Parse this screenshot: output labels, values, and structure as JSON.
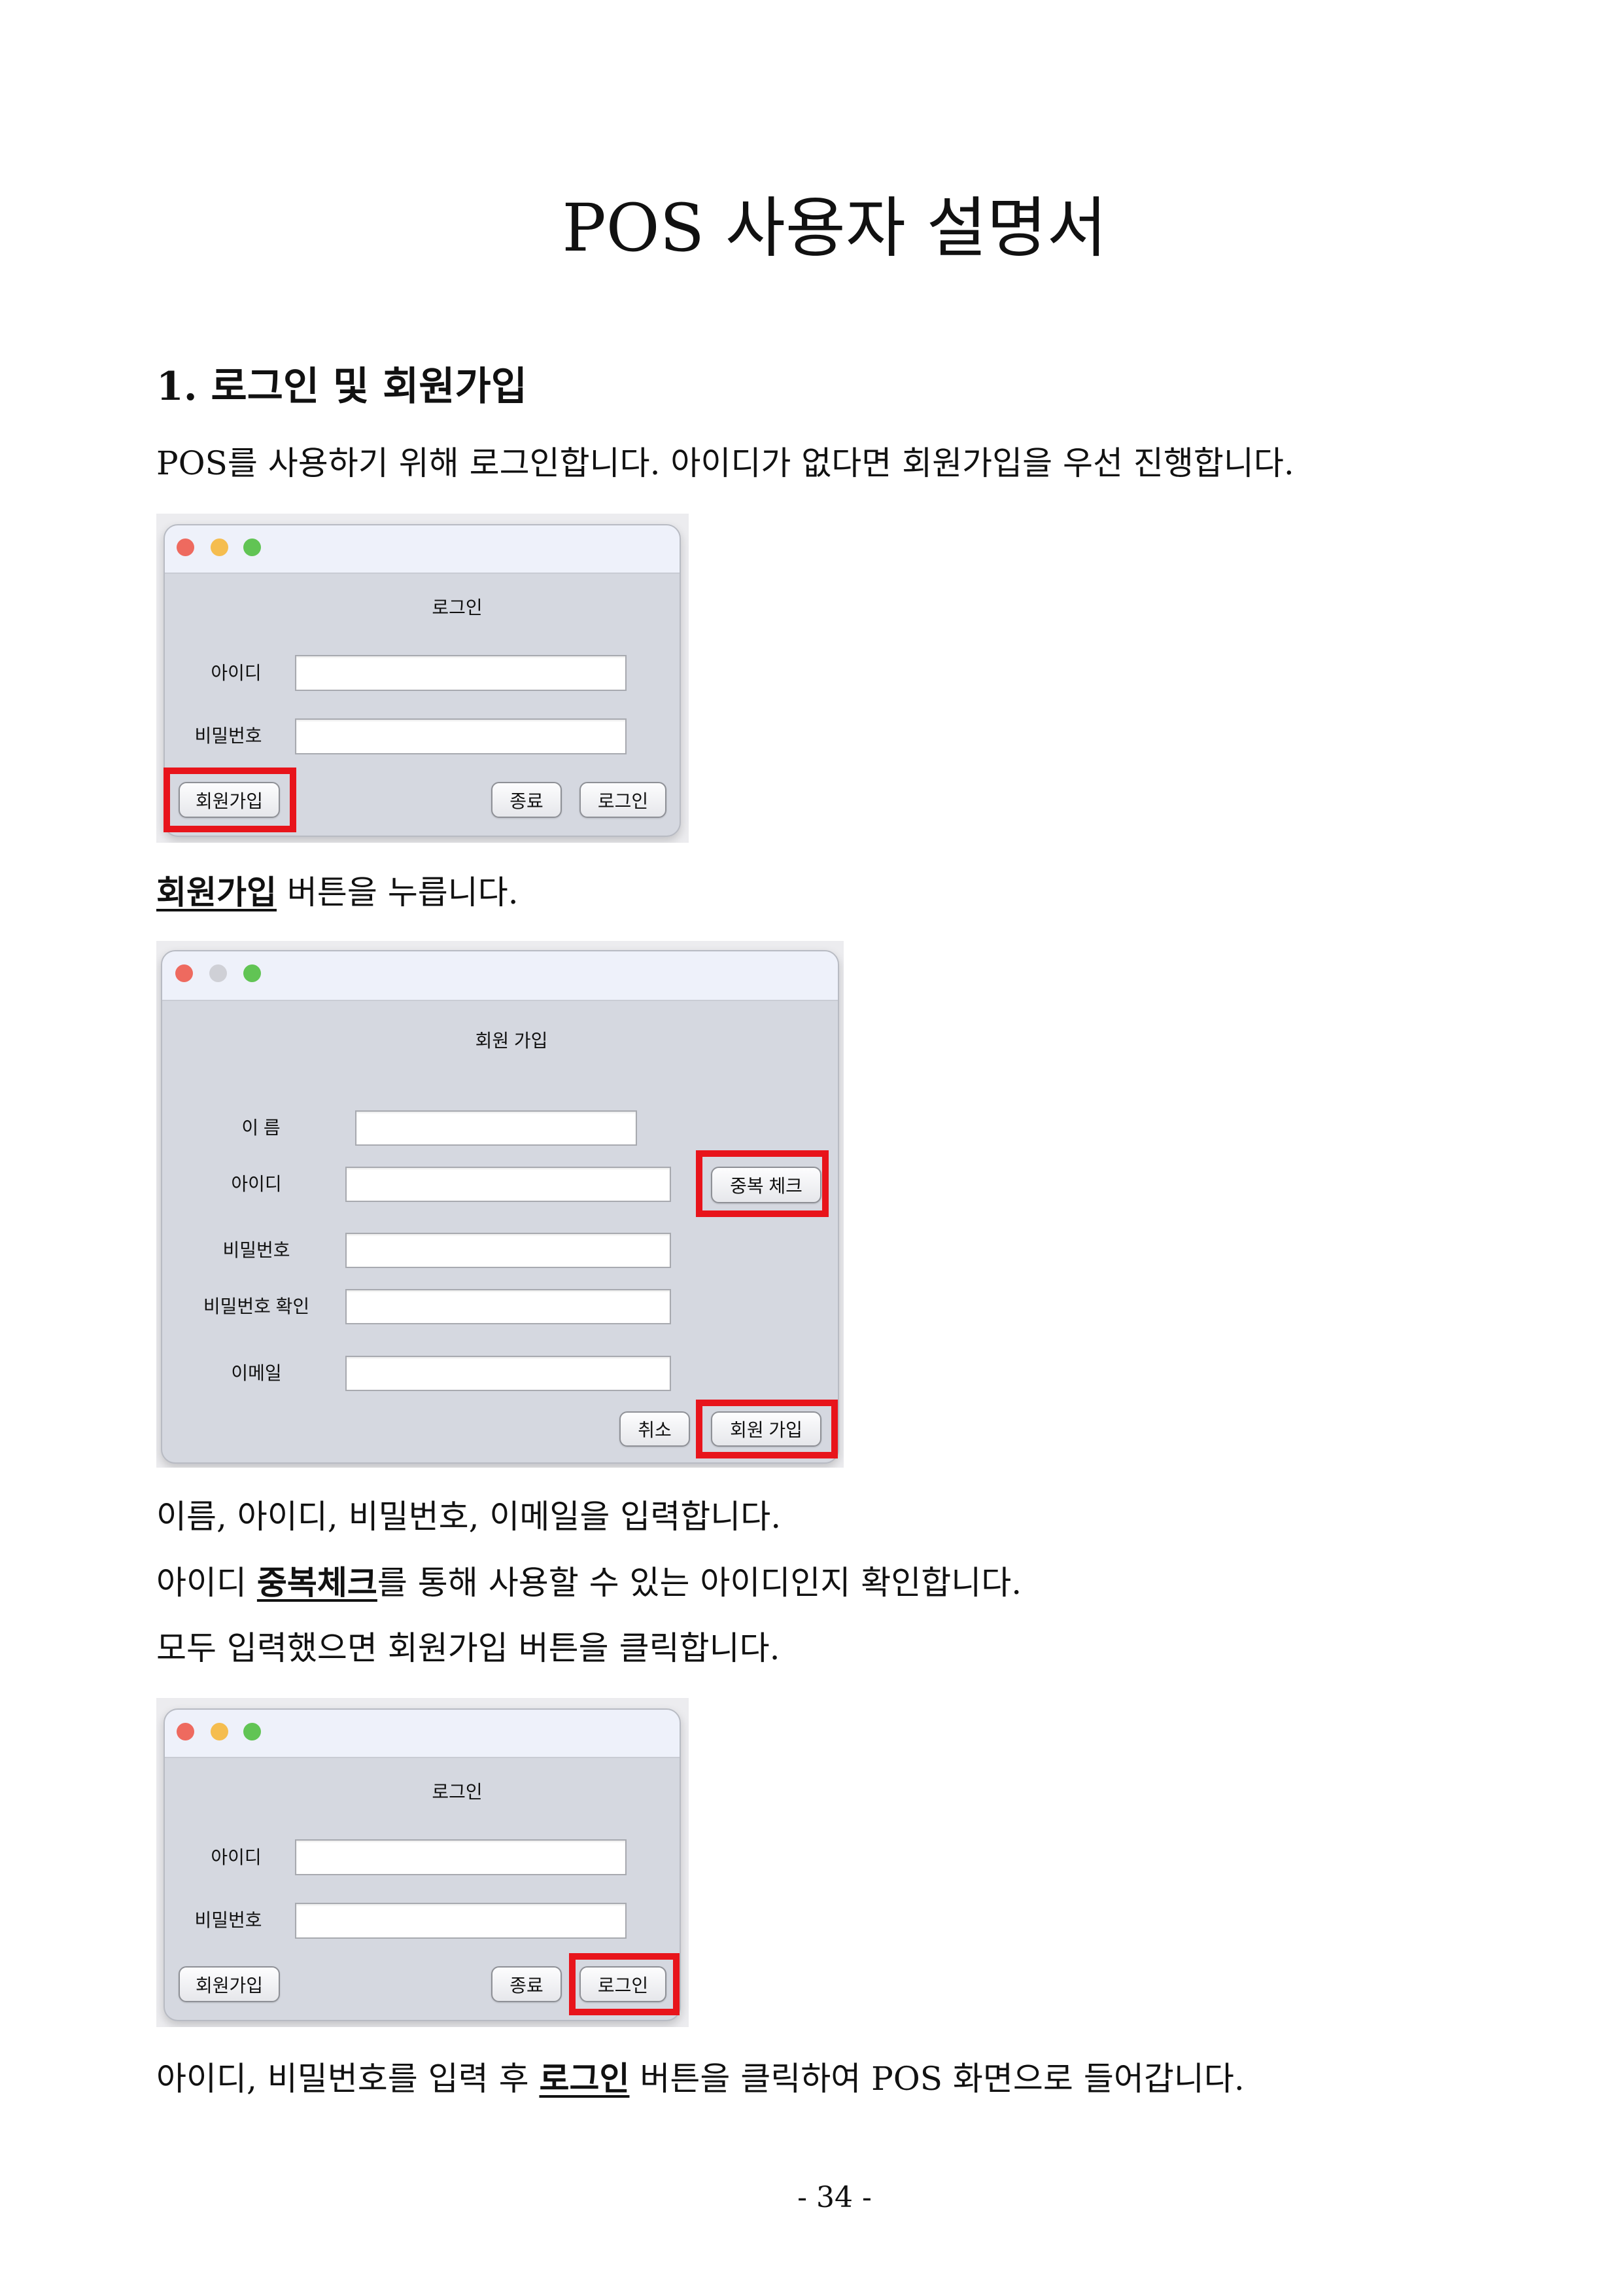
{
  "colors": {
    "highlight": "#e8141b",
    "titlebar": "#eef1fa",
    "window": "#d5d8e0",
    "light_red": "#ee6a5f",
    "light_yellow": "#f5bd4f",
    "light_green": "#61c454",
    "light_inactive": "#cfd0d6"
  },
  "document": {
    "title": "POS 사용자 설명서",
    "section_heading": "1. 로그인 및 회원가입",
    "intro": "POS를 사용하기 위해 로그인합니다. 아이디가 없다면 회원가입을 우선 진행합니다.",
    "step_signup": {
      "emphasis": "회원가입",
      "text": " 버튼을 누릅니다."
    },
    "step_fill": "이름, 아이디, 비밀번호, 이메일을 입력합니다.",
    "step_check": {
      "before": "아이디 ",
      "emphasis": "중복체크",
      "after": "를 통해 사용할 수 있는 아이디인지 확인합니다."
    },
    "step_submit": "모두 입력했으면 회원가입 버튼을 클릭합니다.",
    "step_login": {
      "before": "아이디, 비밀번호를 입력 후 ",
      "emphasis": "로그인",
      "after": " 버튼을 클릭하여 POS 화면으로 들어갑니다."
    },
    "page_number": "- 34 -"
  },
  "figures": [
    {
      "window_title": "로그인",
      "id_label": "아이디",
      "id_value": "",
      "password_label": "비밀번호",
      "password_value": "",
      "signup_button": "회원가입",
      "exit_button": "종료",
      "login_button": "로그인"
    },
    {
      "window_title": "회원 가입",
      "name_label": "이 름",
      "name_value": "",
      "id_label": "아이디",
      "id_value": "",
      "check_button": "중복 체크",
      "password_label": "비밀번호",
      "password_value": "",
      "password_confirm_label": "비밀번호 확인",
      "password_confirm_value": "",
      "email_label": "이메일",
      "email_value": "",
      "cancel_button": "취소",
      "submit_button": "회원 가입"
    },
    {
      "window_title": "로그인",
      "id_label": "아이디",
      "id_value": "",
      "password_label": "비밀번호",
      "password_value": "",
      "signup_button": "회원가입",
      "exit_button": "종료",
      "login_button": "로그인"
    }
  ]
}
